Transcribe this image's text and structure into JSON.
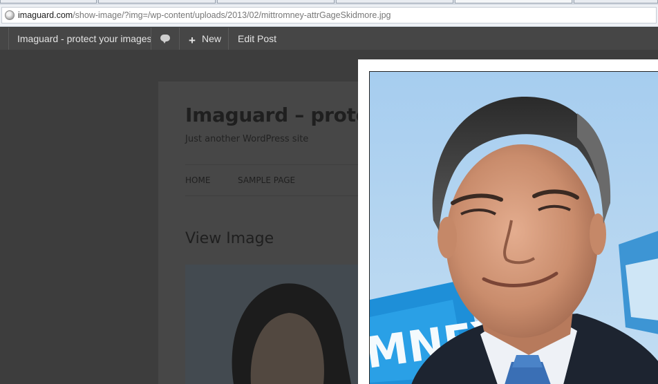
{
  "browser": {
    "url_domain": "imaguard.com",
    "url_path": "/show-image/?img=/wp-content/uploads/2013/02/mittromney-attrGageSkidmore.jpg"
  },
  "adminbar": {
    "site_name": "Imaguard - protect your images",
    "new_label": "New",
    "edit_label": "Edit Post",
    "comment_icon": "comment-icon",
    "plus_icon": "plus-icon"
  },
  "site": {
    "title": "Imaguard – protect",
    "description": "Just another WordPress site",
    "nav": [
      "HOME",
      "SAMPLE PAGE"
    ],
    "page_title": "View Image"
  },
  "lightbox": {
    "image": "portrait-photo"
  },
  "colors": {
    "adminbar": "#464646",
    "overlay": "#3d3d3d",
    "sky": "#a9cfee",
    "suit": "#1d2430"
  }
}
